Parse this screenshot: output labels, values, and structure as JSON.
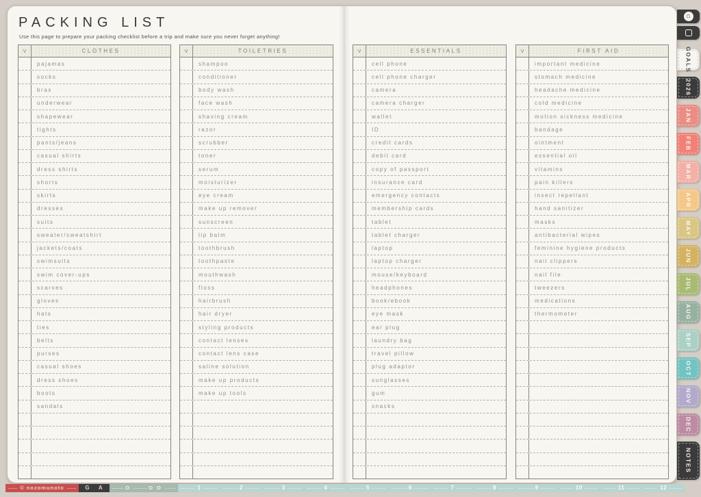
{
  "page": {
    "title": "PACKING LIST",
    "subtitle": "Use this page to prepare your packing checklist before a trip and make sure you never forget anything!"
  },
  "colors": {
    "background": "#d5cec6",
    "paper": "#f8f6f1",
    "table_header_bg": "#ebe9dd",
    "table_border": "#85847d",
    "item_text": "#8f8f88"
  },
  "tables": [
    {
      "check_header": "V",
      "header": "CLOTHES",
      "row_count": 32,
      "items": [
        "pajamas",
        "socks",
        "bras",
        "underwear",
        "shapewear",
        "tights",
        "pants/jeans",
        "casual shirts",
        "dress shirts",
        "shorts",
        "skirts",
        "dresses",
        "suits",
        "sweater/sweatshirt",
        "jackets/coats",
        "swimsuits",
        "swim cover-ups",
        "scarves",
        "gloves",
        "hats",
        "ties",
        "belts",
        "purses",
        "casual shoes",
        "dress shoes",
        "boots",
        "sandals"
      ]
    },
    {
      "check_header": "V",
      "header": "TOILETRIES",
      "row_count": 32,
      "items": [
        "shampoo",
        "conditioner",
        "body wash",
        "face wash",
        "shaving cream",
        "razor",
        "scrubber",
        "toner",
        "serum",
        "moisturizer",
        "eye cream",
        "make up remover",
        "sunscreen",
        "lip balm",
        "toothbrush",
        "toothpaste",
        "mouthwash",
        "floss",
        "hairbrush",
        "hair dryer",
        "styling products",
        "contact lenses",
        "contact lens case",
        "saline solution",
        "make up products",
        "make up tools"
      ]
    },
    {
      "check_header": "V",
      "header": "ESSENTIALS",
      "row_count": 32,
      "items": [
        "cell phone",
        "cell phone charger",
        "camera",
        "camera charger",
        "wallet",
        "ID",
        "credit cards",
        "debit card",
        "copy of passport",
        "insurance card",
        "emergency contacts",
        "membership cards",
        "tablet",
        "tablet charger",
        "laptop",
        "laptop charger",
        "mouse/keyboard",
        "headphones",
        "book/ebook",
        "eye mask",
        "ear plug",
        "laundry bag",
        "travel pillow",
        "plug adaptor",
        "sunglasses",
        "gum",
        "snacks"
      ]
    },
    {
      "check_header": "V",
      "header": "FIRST AID",
      "row_count": 32,
      "items": [
        "important medicine",
        "stomach medicine",
        "headache medicine",
        "cold medicine",
        "motion sickness medicine",
        "bandage",
        "ointment",
        "essential oil",
        "vitamins",
        "pain killers",
        "insect repellant",
        "hand sanitizer",
        "masks",
        "antibacterial wipes",
        "feminine hygiene products",
        "nail clippers",
        "nail file",
        "tweezers",
        "medications",
        "thermometer"
      ]
    }
  ],
  "side_tabs": {
    "buttons": [
      {
        "name": "home",
        "icon": "home-icon",
        "bg": "#3b3b3b"
      },
      {
        "name": "page-border",
        "icon": "square-icon",
        "bg": "#3b3b3b"
      }
    ],
    "tabs": [
      {
        "label": "GOALS",
        "bg": "#f7f5f0",
        "fg": "#4b4b48",
        "light": true
      },
      {
        "label": "2026",
        "bg": "#3b3b3b",
        "fg": "#f0efec"
      },
      {
        "label": "JAN",
        "bg": "#ea8d84",
        "fg": "#fdf3ee"
      },
      {
        "label": "FEB",
        "bg": "#f08177",
        "fg": "#fdf3ee"
      },
      {
        "label": "MAR",
        "bg": "#f2b0a7",
        "fg": "#fdf6f2"
      },
      {
        "label": "APR",
        "bg": "#f5c788",
        "fg": "#fdf8ef"
      },
      {
        "label": "MAY",
        "bg": "#d9c584",
        "fg": "#faf7ec"
      },
      {
        "label": "JUN",
        "bg": "#d3b262",
        "fg": "#faf6e9"
      },
      {
        "label": "JUL",
        "bg": "#a9bb72",
        "fg": "#f7f9ec"
      },
      {
        "label": "AUG",
        "bg": "#97b1a1",
        "fg": "#f3f7f3"
      },
      {
        "label": "SEP",
        "bg": "#abd0c6",
        "fg": "#f5faf8"
      },
      {
        "label": "OCT",
        "bg": "#74c2c2",
        "fg": "#f2fafa"
      },
      {
        "label": "NOV",
        "bg": "#b2a9cb",
        "fg": "#f7f5fa"
      },
      {
        "label": "DEC",
        "bg": "#bd8ba3",
        "fg": "#faf3f6"
      },
      {
        "label": "NOTES",
        "bg": "#3b3b3b",
        "fg": "#f0efec",
        "tall": true
      }
    ]
  },
  "footer": {
    "brand": "© nozomunoto",
    "dark_labels": [
      "G",
      "A"
    ],
    "sage_labels": [
      "O",
      "O O"
    ],
    "ruler_numbers": [
      "1",
      "2",
      "3",
      "4",
      "5",
      "6",
      "7",
      "8",
      "9",
      "10",
      "11",
      "12"
    ],
    "colors": {
      "brand_bg": "#c6504f",
      "brand_fg": "#f2d2c9",
      "dark_bg": "#3b3b3b",
      "dark_fg": "#d6d6d1",
      "sage_bg": "#a6baad",
      "sage_fg": "#f6f6f1",
      "ruler_bg": "#b9d5d1",
      "ruler_fg": "#fcfcf9"
    }
  }
}
